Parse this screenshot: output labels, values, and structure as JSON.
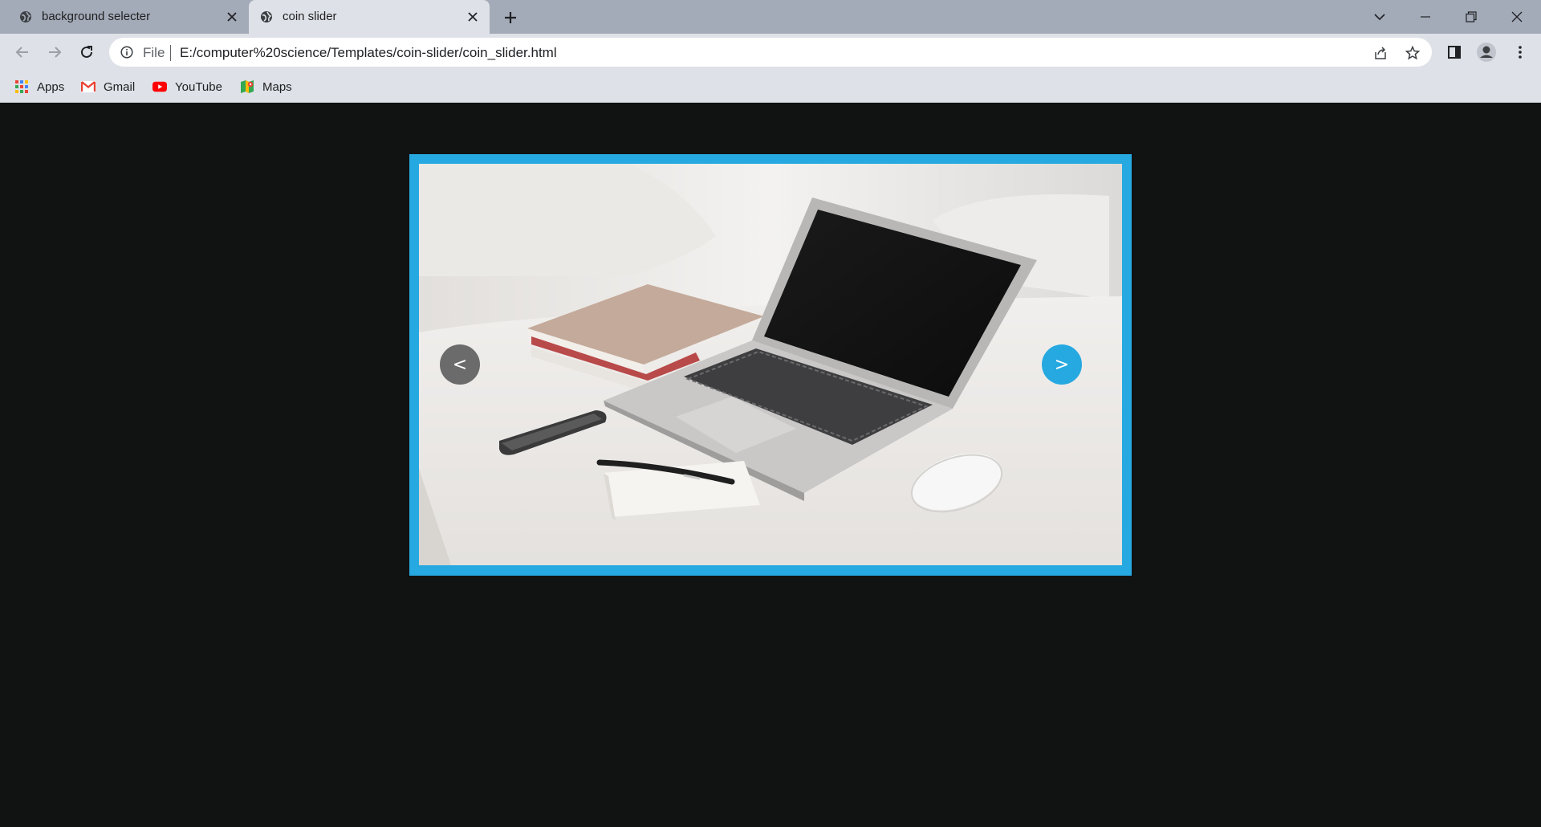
{
  "browser": {
    "tabs": [
      {
        "title": "background selecter",
        "active": false
      },
      {
        "title": "coin slider",
        "active": true
      }
    ],
    "address_bar": {
      "scheme_label": "File",
      "url": "E:/computer%20science/Templates/coin-slider/coin_slider.html"
    },
    "bookmarks": [
      {
        "label": "Apps",
        "icon": "apps-grid-icon"
      },
      {
        "label": "Gmail",
        "icon": "gmail-icon"
      },
      {
        "label": "YouTube",
        "icon": "youtube-icon"
      },
      {
        "label": "Maps",
        "icon": "maps-icon"
      }
    ]
  },
  "slider": {
    "prev_label": "<",
    "next_label": ">",
    "image_subject": "laptop-on-desk-photo",
    "colors": {
      "frame": "#26a9e0",
      "prev_button": "#6b6b6b",
      "next_button": "#26a9e0"
    }
  },
  "colors": {
    "page_background": "#111212",
    "tabstrip": "#a3aab8",
    "toolbar": "#dee1e7"
  }
}
